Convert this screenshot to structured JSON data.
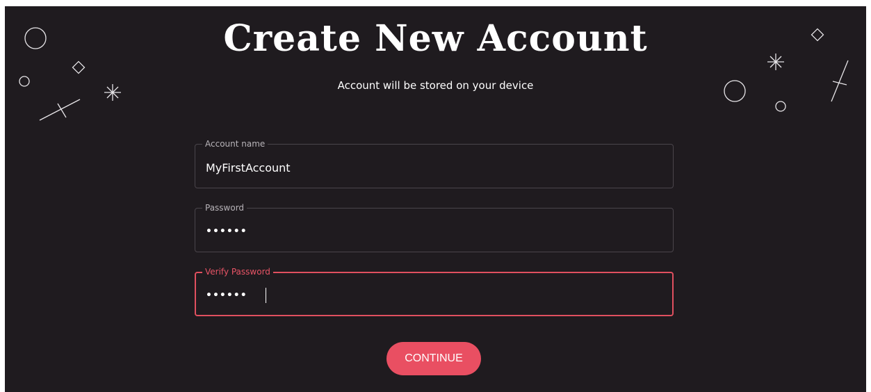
{
  "header": {
    "title": "Create New Account",
    "subtitle": "Account will be stored on your device"
  },
  "form": {
    "account_name": {
      "label": "Account name",
      "value": "MyFirstAccount"
    },
    "password": {
      "label": "Password",
      "value": "••••••"
    },
    "verify_password": {
      "label": "Verify Password",
      "value": "••••••"
    }
  },
  "actions": {
    "continue_label": "CONTINUE"
  },
  "colors": {
    "background": "#1f1b1f",
    "accent": "#e94f62",
    "text": "#ffffff",
    "border": "#4a454b"
  },
  "decorations": {
    "left": [
      "circle-icon",
      "diamond-icon",
      "circle-icon",
      "sparkle-icon",
      "line-icon"
    ],
    "right": [
      "diamond-icon",
      "sparkle-icon",
      "line-icon",
      "circle-icon",
      "circle-icon"
    ]
  }
}
